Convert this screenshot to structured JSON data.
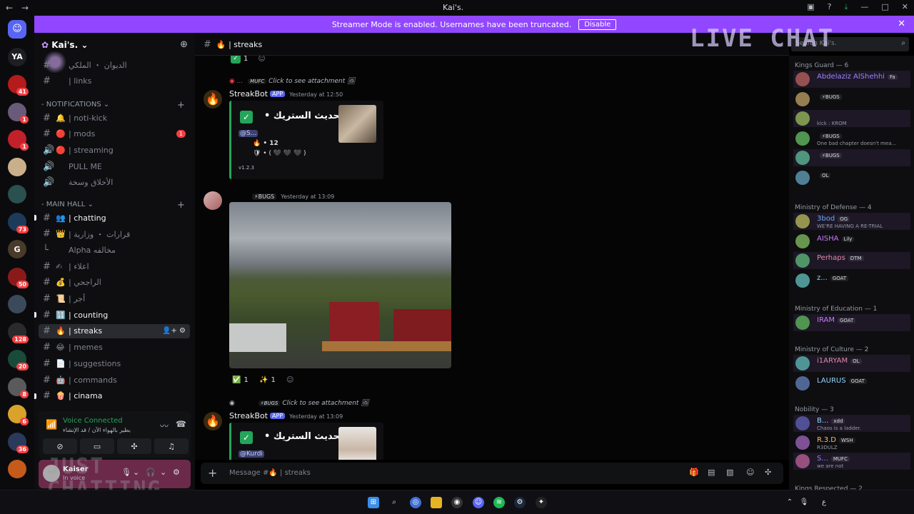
{
  "window": {
    "title": "Kai's.",
    "nav_back": "←",
    "nav_fwd": "→"
  },
  "banner": {
    "text": "Streamer Mode is enabled. Usernames have been truncated.",
    "button": "Disable"
  },
  "overlay": {
    "live_chat": "LIVE CHAT",
    "just_chatting_1": "JUST",
    "just_chatting_2": "CHATTING"
  },
  "guilds": [
    {
      "label": "",
      "badge": ""
    },
    {
      "label": "YA",
      "badge": ""
    },
    {
      "label": "",
      "badge": "41"
    },
    {
      "label": "",
      "badge": "1"
    },
    {
      "label": "",
      "badge": "1"
    },
    {
      "label": "",
      "badge": ""
    },
    {
      "label": "",
      "badge": ""
    },
    {
      "label": "",
      "badge": "73"
    },
    {
      "label": "G",
      "badge": ""
    },
    {
      "label": "",
      "badge": "50"
    },
    {
      "label": "",
      "badge": ""
    },
    {
      "label": "",
      "badge": "128"
    },
    {
      "label": "",
      "badge": "20"
    },
    {
      "label": "",
      "badge": "8"
    },
    {
      "label": "",
      "badge": "6"
    },
    {
      "label": "",
      "badge": "36"
    },
    {
      "label": "",
      "badge": ""
    }
  ],
  "server": {
    "name": "Kai's."
  },
  "channels_top": [
    {
      "name": "الديوان ・ الملكي",
      "emoji": ""
    },
    {
      "name": "| links",
      "emoji": ""
    }
  ],
  "categories": {
    "notifications": "NOTIFICATIONS",
    "main_hall": "MAIN HALL"
  },
  "channels_notif": [
    {
      "name": "| noti-kick",
      "emoji": "🔔",
      "icon": "#"
    },
    {
      "name": "| mods",
      "emoji": "🔴",
      "icon": "#",
      "badge": "1"
    },
    {
      "name": "| streaming",
      "emoji": "🔴",
      "icon": "🔊"
    },
    {
      "name": "PULL ME",
      "emoji": "",
      "icon": "🔊"
    },
    {
      "name": "الأخلاق وسخة",
      "emoji": "",
      "icon": "🔊"
    }
  ],
  "channels_main": [
    {
      "name": "| chatting",
      "emoji": "👥",
      "icon": "#",
      "bright": true
    },
    {
      "name": "| قرارات ・ وزارية",
      "emoji": "👑",
      "icon": "#"
    },
    {
      "name": "Alpha مخالفه",
      "emoji": "",
      "icon": "└"
    },
    {
      "name": "| اعلاء",
      "emoji": "✍",
      "icon": "#"
    },
    {
      "name": "| الراجحي",
      "emoji": "💰",
      "icon": "#"
    },
    {
      "name": "| أجر",
      "emoji": "📜",
      "icon": "#"
    },
    {
      "name": "| counting",
      "emoji": "🔢",
      "icon": "#",
      "bright": true
    },
    {
      "name": "| streaks",
      "emoji": "🔥",
      "icon": "#",
      "active": true
    },
    {
      "name": "| memes",
      "emoji": "😂",
      "icon": "#"
    },
    {
      "name": "| suggestions",
      "emoji": "📄",
      "icon": "#"
    },
    {
      "name": "| commands",
      "emoji": "🤖",
      "icon": "#"
    },
    {
      "name": "| cinama",
      "emoji": "🍿",
      "icon": "#",
      "bright": true
    }
  ],
  "voice": {
    "status": "Voice Connected",
    "channel": "بطير بالهواء الآن / قد الإنشاء"
  },
  "user": {
    "name": "Kaiser",
    "status": "In voice"
  },
  "chat": {
    "channel": "| streaks",
    "top_reaction": "1",
    "msg1": {
      "reply_tag": "MUFC",
      "reply_text": "Click to see attachment",
      "author": "StreakBot",
      "app": "APP",
      "time": "Yesterday at 12:50",
      "embed_title": "تم تحديث الستريك •",
      "mention": "@S...",
      "streak": "• 12",
      "shield": "• ( 🖤 🖤 🖤 )",
      "version": "v1.2.3"
    },
    "msg2": {
      "author_tag": "⚡BUGS",
      "time": "Yesterday at 13:09",
      "reactions": [
        {
          "emoji": "✅",
          "count": "1"
        },
        {
          "emoji": "✨",
          "count": "1"
        }
      ]
    },
    "msg3": {
      "reply_tag": "⚡BUGS",
      "reply_text": "Click to see attachment",
      "author": "StreakBot",
      "app": "APP",
      "time": "Yesterday at 13:09",
      "embed_title": "تم تحديث الستريك •",
      "mention": "@Kurdi"
    },
    "composer_placeholder": "Message #🔥 | streaks"
  },
  "search": {
    "placeholder": "Search Kai's."
  },
  "members": {
    "groups": [
      {
        "title": "Kings Guard — 6",
        "rows": [
          {
            "name": "Abdelaziz AlShehhi",
            "tag": "Fa",
            "sub": ""
          },
          {
            "name": "",
            "tag": "⚡BUGS",
            "sub": ""
          },
          {
            "name": "",
            "tag": "",
            "sub": "kick : KROM"
          },
          {
            "name": "",
            "tag": "⚡BUGS",
            "sub": "One bad chapter doesn't mea..."
          },
          {
            "name": "",
            "tag": "⚡BUGS",
            "sub": ""
          },
          {
            "name": "",
            "tag": "OL",
            "sub": ""
          }
        ]
      },
      {
        "title": "Ministry of Defense — 4",
        "rows": [
          {
            "name": "3bod",
            "tag": "OG",
            "sub": "WE'RE HAVING A RE-TRIAL"
          },
          {
            "name": "AISHA",
            "tag": "Lily",
            "sub": ""
          },
          {
            "name": "Perhaps",
            "tag": "DTM",
            "sub": ""
          },
          {
            "name": "z...",
            "tag": "GOAT",
            "sub": ""
          }
        ]
      },
      {
        "title": "Ministry of Education — 1",
        "rows": [
          {
            "name": "IRAM",
            "tag": "GOAT",
            "sub": ""
          }
        ]
      },
      {
        "title": "Ministry of Culture — 2",
        "rows": [
          {
            "name": "i1ARYAM",
            "tag": "OL",
            "sub": ""
          },
          {
            "name": "LAURUS",
            "tag": "GOAT",
            "sub": ""
          }
        ]
      },
      {
        "title": "Nobility — 3",
        "rows": [
          {
            "name": "B...",
            "tag": "xdd",
            "sub": "Chaos is a ladder."
          },
          {
            "name": "R.3.D",
            "tag": "WSH",
            "sub": "R3DULZ"
          },
          {
            "name": "S...",
            "tag": "MUFC",
            "sub": "we are not"
          }
        ]
      },
      {
        "title": "Kings Respected — 2",
        "rows": []
      }
    ]
  },
  "colors": {
    "accent": "#9147ff",
    "online": "#23a55a",
    "mention_badge": "#f23f43"
  }
}
